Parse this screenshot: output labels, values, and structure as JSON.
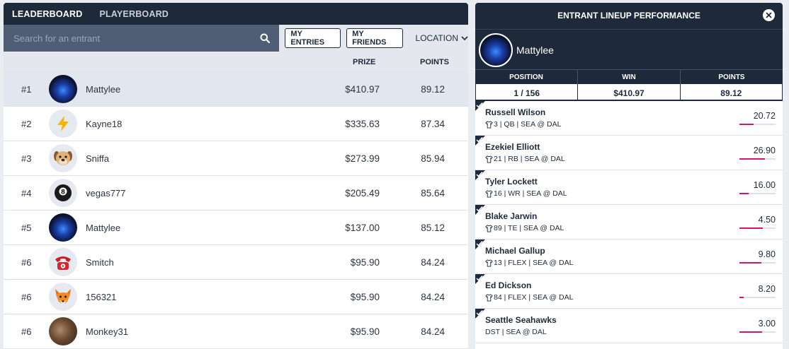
{
  "tabs": {
    "leaderboard": "LEADERBOARD",
    "playerboard": "PLAYERBOARD"
  },
  "toolbar": {
    "search_placeholder": "Search for an entrant",
    "my_entries": "MY ENTRIES",
    "my_friends": "MY FRIENDS",
    "location": "LOCATION"
  },
  "columns": {
    "prize": "PRIZE",
    "points": "POINTS"
  },
  "entrants": [
    {
      "rank": "#1",
      "name": "Mattylee",
      "prize": "$410.97",
      "points": "89.12",
      "avatar": "galaxy-avatar"
    },
    {
      "rank": "#2",
      "name": "Kayne18",
      "prize": "$335.63",
      "points": "87.34",
      "avatar": "lightning-avatar"
    },
    {
      "rank": "#3",
      "name": "Sniffa",
      "prize": "$273.99",
      "points": "85.94",
      "avatar": "dog-avatar"
    },
    {
      "rank": "#4",
      "name": "vegas777",
      "prize": "$205.49",
      "points": "85.64",
      "avatar": "eight-ball-avatar"
    },
    {
      "rank": "#5",
      "name": "Mattylee",
      "prize": "$137.00",
      "points": "85.12",
      "avatar": "galaxy-avatar"
    },
    {
      "rank": "#6",
      "name": "Smitch",
      "prize": "$95.90",
      "points": "84.24",
      "avatar": "telephone-avatar"
    },
    {
      "rank": "#6",
      "name": "156321",
      "prize": "$95.90",
      "points": "84.24",
      "avatar": "fox-avatar"
    },
    {
      "rank": "#6",
      "name": "Monkey31",
      "prize": "$95.90",
      "points": "84.24",
      "avatar": "photo-avatar"
    }
  ],
  "panel": {
    "title": "ENTRANT LINEUP PERFORMANCE",
    "user": "Mattylee",
    "stats_headers": {
      "position": "POSITION",
      "win": "WIN",
      "points": "POINTS"
    },
    "stats": {
      "position": "1 / 156",
      "win": "$410.97",
      "points": "89.12"
    },
    "players": [
      {
        "name": "Russell Wilson",
        "info": "3 | QB | SEA @ DAL",
        "jersey": true,
        "score": "20.72",
        "bar": 0.4
      },
      {
        "name": "Ezekiel Elliott",
        "info": "21 | RB | SEA @ DAL",
        "jersey": true,
        "score": "26.90",
        "bar": 0.7
      },
      {
        "name": "Tyler Lockett",
        "info": "16 | WR | SEA @ DAL",
        "jersey": true,
        "score": "16.00",
        "bar": 0.25
      },
      {
        "name": "Blake Jarwin",
        "info": "89 | TE | SEA @ DAL",
        "jersey": true,
        "score": "4.50",
        "bar": 0.65
      },
      {
        "name": "Michael Gallup",
        "info": "13 | FLEX | SEA @ DAL",
        "jersey": true,
        "score": "9.80",
        "bar": 0.6
      },
      {
        "name": "Ed Dickson",
        "info": "84 | FLEX | SEA @ DAL",
        "jersey": true,
        "score": "8.20",
        "bar": 0.12
      },
      {
        "name": "Seattle Seahawks",
        "info": "DST | SEA @ DAL",
        "jersey": false,
        "score": "3.00",
        "bar": 0.62
      }
    ]
  },
  "colors": {
    "navy": "#1e2a3a",
    "search_bg": "#4f5e74",
    "bar_accent": "#d6146a",
    "highlight_row": "#e2e6ee"
  }
}
